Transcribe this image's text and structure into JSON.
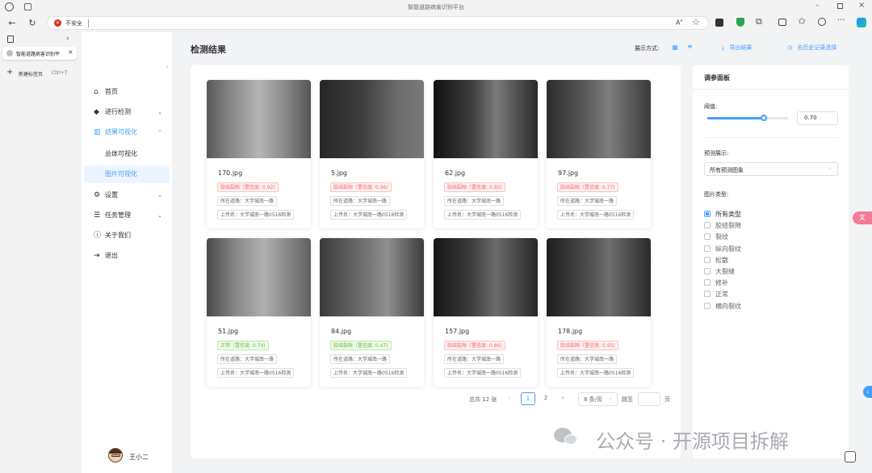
{
  "browser": {
    "title": "智能道路病害识别平台",
    "security_label": "不安全",
    "tab_title": "智能道路病害识别平",
    "new_tab_label": "新建标签页",
    "new_tab_shortcut": "Ctrl+T"
  },
  "sidebar": {
    "items": [
      {
        "label": "首页",
        "icon": "home-icon"
      },
      {
        "label": "进行检测",
        "icon": "box-icon"
      },
      {
        "label": "结果可视化",
        "icon": "chart-icon"
      },
      {
        "label": "总体可视化"
      },
      {
        "label": "图片可视化"
      },
      {
        "label": "设置",
        "icon": "gear-icon"
      },
      {
        "label": "任务管理",
        "icon": "task-icon"
      },
      {
        "label": "关于我们",
        "icon": "info-icon"
      },
      {
        "label": "退出",
        "icon": "logout-icon"
      }
    ],
    "user_name": "王小二"
  },
  "header": {
    "title": "检测结果",
    "display_mode_label": "展示方式:",
    "export_label": "导出结果",
    "history_label": "去历史记录选择"
  },
  "cards": [
    {
      "name": "170.jpg",
      "tag": "胶结裂隙（置信度: 0.92)",
      "tag_type": "red",
      "road": "所在道路：大学城南一路",
      "uploader": "上传名：大学城南一路0516检测"
    },
    {
      "name": "5.jpg",
      "tag": "胶结裂隙（置信度: 0.96)",
      "tag_type": "red",
      "road": "所在道路：大学城南一路",
      "uploader": "上传名：大学城南一路0516检测"
    },
    {
      "name": "62.jpg",
      "tag": "胶结裂隙（置信度: 0.95)",
      "tag_type": "red",
      "road": "所在道路：大学城南一路",
      "uploader": "上传名：大学城南一路0516检测"
    },
    {
      "name": "97.jpg",
      "tag": "胶结裂隙（置信度: 0.77)",
      "tag_type": "red",
      "road": "所在道路：大学城南一路",
      "uploader": "上传名：大学城南一路0516检测"
    },
    {
      "name": "51.jpg",
      "tag": "正常（置信度: 0.74)",
      "tag_type": "green",
      "road": "所在道路：大学城南一路",
      "uploader": "上传名：大学城南一路0516检测"
    },
    {
      "name": "84.jpg",
      "tag": "胶结裂隙（置信度: 0.47)",
      "tag_type": "green",
      "road": "所在道路：大学城南一路",
      "uploader": "上传名：大学城南一路0516检测"
    },
    {
      "name": "157.jpg",
      "tag": "胶结裂隙（置信度: 0.86)",
      "tag_type": "red",
      "road": "所在道路：大学城南一路",
      "uploader": "上传名：大学城南一路0516检测"
    },
    {
      "name": "178.jpg",
      "tag": "胶结裂隙（置信度: 0.95)",
      "tag_type": "red",
      "road": "所在道路：大学城南一路",
      "uploader": "上传名：大学城南一路0516检测"
    }
  ],
  "pagination": {
    "total": "总共 12 张",
    "pages": [
      "1",
      "2"
    ],
    "page_size": "8 条/页",
    "jump_label": "跳至",
    "page_unit": "页"
  },
  "panel": {
    "title": "调参面板",
    "threshold_label": "阈值:",
    "threshold_value": "0.70",
    "threshold_fraction": 0.7,
    "prediction_label": "预测展示:",
    "prediction_value": "所有预测图象",
    "type_label": "图片类型:",
    "types": [
      "所有类型",
      "胶结裂隙",
      "裂纹",
      "纵向裂纹",
      "松散",
      "大裂缝",
      "修补",
      "正常",
      "横向裂纹"
    ]
  },
  "watermark": "公众号 · 开源项目拆解",
  "colors": {
    "accent": "#409eff",
    "danger": "#f56c6c",
    "success": "#67c23a"
  }
}
